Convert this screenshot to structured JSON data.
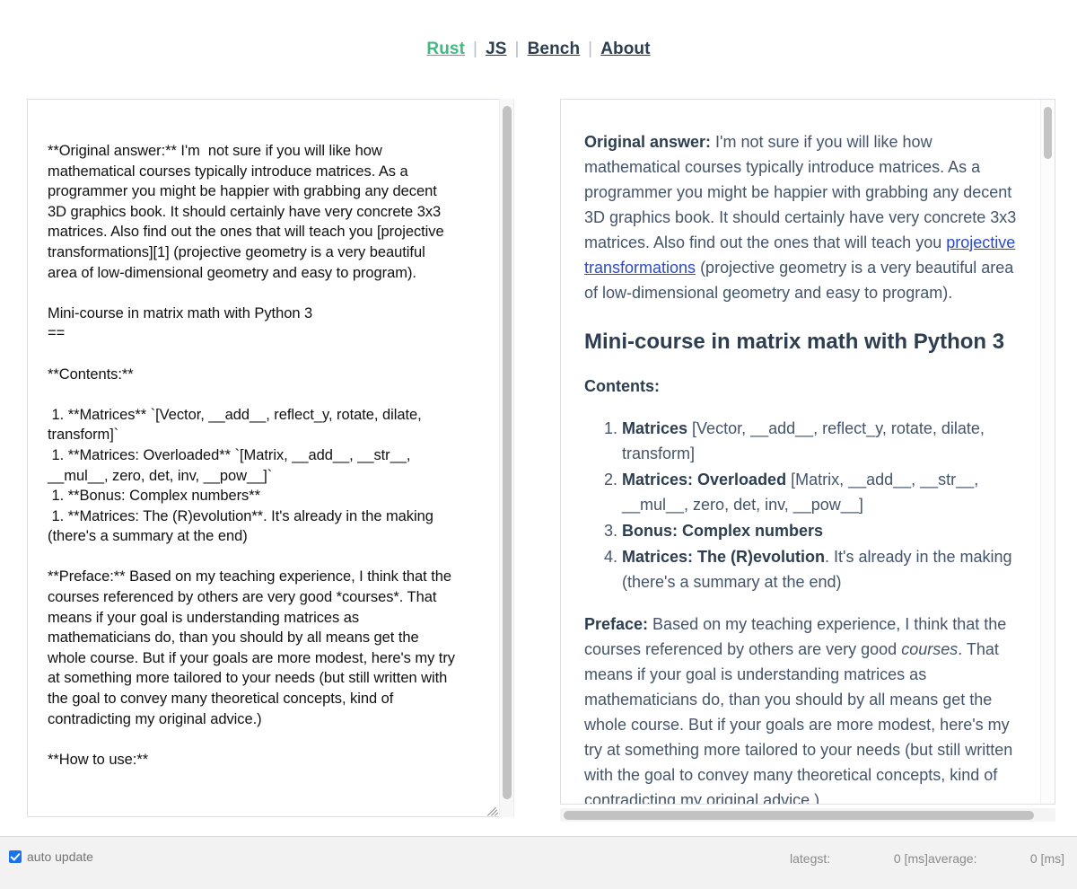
{
  "nav": {
    "separator": "|",
    "items": [
      {
        "label": "Rust",
        "active": true
      },
      {
        "label": "JS",
        "active": false
      },
      {
        "label": "Bench",
        "active": false
      },
      {
        "label": "About",
        "active": false
      }
    ]
  },
  "editor": {
    "value": "**Original answer:** I'm  not sure if you will like how mathematical courses typically introduce matrices. As a programmer you might be happier with grabbing any decent 3D graphics book. It should certainly have very concrete 3x3 matrices. Also find out the ones that will teach you [projective transformations][1] (projective geometry is a very beautiful area of low-dimensional geometry and easy to program).\n\nMini-course in matrix math with Python 3\n==\n\n**Contents:**\n\n 1. **Matrices** `[Vector, __add__, reflect_y, rotate, dilate, transform]`\n 1. **Matrices: Overloaded** `[Matrix, __add__, __str__, __mul__, zero, det, inv, __pow__]`\n 1. **Bonus: Complex numbers**\n 1. **Matrices: The (R)evolution**. It's already in the making (there's a summary at the end)\n\n**Preface:** Based on my teaching experience, I think that the courses referenced by others are very good *courses*. That means if your goal is understanding matrices as mathematicians do, than you should by all means get the whole course. But if your goals are more modest, here's my try at something more tailored to your needs (but still written with the goal to convey many theoretical concepts, kind of contradicting my original advice.)\n\n**How to use:**",
    "placeholder": "",
    "resize_handle": "resize-grip"
  },
  "preview": {
    "paragraph_1": {
      "lead": "Original answer:",
      "text_before_link": " I'm not sure if you will like how mathematical courses typically introduce matrices. As a programmer you might be happier with grabbing any decent 3D graphics book. It should certainly have very concrete 3x3 matrices. Also find out the ones that will teach you ",
      "link": "projective transformations",
      "text_after_link": " (projective geometry is a very beautiful area of low-dimensional geometry and easy to program)."
    },
    "heading": "Mini-course in matrix math with Python 3",
    "contents_label": "Contents:",
    "list": [
      {
        "bold": "Matrices",
        "rest": " [Vector, __add__, reflect_y, rotate, dilate, transform]"
      },
      {
        "bold": "Matrices: Overloaded",
        "rest": " [Matrix, __add__, __str__, __mul__, zero, det, inv, __pow__]"
      },
      {
        "bold": "Bonus: Complex numbers",
        "rest": ""
      },
      {
        "bold": "Matrices: The (R)evolution",
        "rest": ". It's already in the making (there's a summary at the end)"
      }
    ],
    "paragraph_2": {
      "lead": "Preface:",
      "text_1": " Based on my teaching experience, I think that the courses referenced by others are very good ",
      "em": "courses",
      "text_2": ". That means if your goal is understanding matrices as mathematicians do, than you should by all means get the whole course. But if your goals are more modest, here's my try at something more tailored to your needs (but still written with the goal to convey many theoretical concepts, kind of contradicting my original advice.)"
    }
  },
  "footer": {
    "auto_update_label": "auto update",
    "auto_update_checked": true,
    "metrics": [
      {
        "label": "lategst:",
        "value": "0 [ms]"
      },
      {
        "label": "average:",
        "value": "0 [ms]"
      }
    ]
  },
  "colors": {
    "accent_green": "#42b983",
    "nav_text": "#2c3e50",
    "preview_text": "#44546a",
    "link_blue": "#2b4ac7",
    "checkbox_blue": "#1a73e8",
    "footer_bg": "#f2f2f2"
  }
}
